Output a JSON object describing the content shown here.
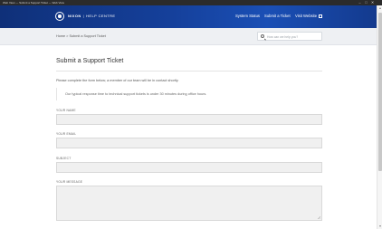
{
  "window": {
    "title": "Web View — Submit a Support Ticket — Web View",
    "minimize_glyph": "–",
    "maximize_glyph": "□",
    "close_glyph": "✕"
  },
  "header": {
    "brand_name": "NIXON",
    "brand_separator": "|",
    "brand_section": "HELP CENTRE",
    "nav": {
      "system_status": "System Status",
      "submit_ticket": "Submit a Ticket",
      "visit_website": "Visit Website"
    }
  },
  "breadcrumb": {
    "text": "Home > Submit a Support Ticket"
  },
  "search": {
    "placeholder": "How can we help you?",
    "value": ""
  },
  "main": {
    "title": "Submit a Support Ticket",
    "intro": "Please complete the form below; a member of our team will be in contact shortly.",
    "note": "Our typical response time to technical support tickets is under 30 minutes during office hours.",
    "fields": {
      "name_label": "YOUR NAME",
      "email_label": "YOUR EMAIL",
      "subject_label": "SUBJECT",
      "message_label": "YOUR MESSAGE"
    }
  },
  "colors": {
    "header_dark": "#0f3079",
    "header_mid": "#1a4fb5",
    "field_bg": "#f0f0f0"
  }
}
